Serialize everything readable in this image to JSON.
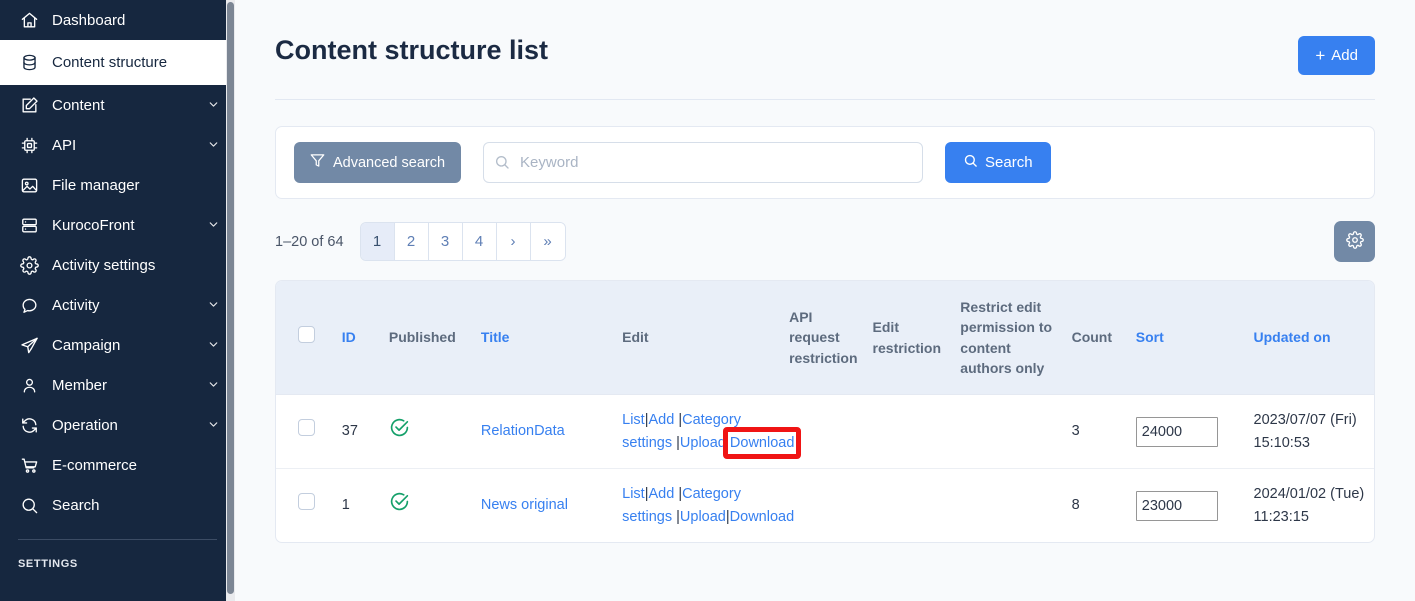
{
  "sidebar": {
    "scroll": "sidebar-scrollbar",
    "items": [
      {
        "id": "dashboard",
        "label": "Dashboard",
        "icon": "home-icon",
        "expandable": false,
        "active": false
      },
      {
        "id": "content-structure",
        "label": "Content structure",
        "icon": "database-icon",
        "expandable": false,
        "active": true
      },
      {
        "id": "content",
        "label": "Content",
        "icon": "edit-square-icon",
        "expandable": true,
        "active": false
      },
      {
        "id": "api",
        "label": "API",
        "icon": "chip-icon",
        "expandable": true,
        "active": false
      },
      {
        "id": "file-manager",
        "label": "File manager",
        "icon": "image-icon",
        "expandable": false,
        "active": false
      },
      {
        "id": "kurocofront",
        "label": "KurocoFront",
        "icon": "server-icon",
        "expandable": true,
        "active": false
      },
      {
        "id": "activity-settings",
        "label": "Activity settings",
        "icon": "gear-icon",
        "expandable": false,
        "active": false
      },
      {
        "id": "activity",
        "label": "Activity",
        "icon": "chat-bubble-icon",
        "expandable": true,
        "active": false
      },
      {
        "id": "campaign",
        "label": "Campaign",
        "icon": "paper-plane-icon",
        "expandable": true,
        "active": false
      },
      {
        "id": "member",
        "label": "Member",
        "icon": "user-icon",
        "expandable": true,
        "active": false
      },
      {
        "id": "operation",
        "label": "Operation",
        "icon": "refresh-icon",
        "expandable": true,
        "active": false
      },
      {
        "id": "e-commerce",
        "label": "E-commerce",
        "icon": "shopping-cart-icon",
        "expandable": false,
        "active": false
      },
      {
        "id": "search",
        "label": "Search",
        "icon": "search-icon",
        "expandable": false,
        "active": false
      }
    ],
    "section_title": "SETTINGS"
  },
  "header": {
    "title": "Content structure list",
    "add_button": {
      "label": "Add",
      "plus": "+"
    }
  },
  "search": {
    "advanced_label": "Advanced search",
    "advanced_icon": "filter-icon",
    "keyword_value": "",
    "keyword_placeholder": "Keyword",
    "keyword_icon": "search-icon",
    "search_label": "Search",
    "search_icon": "search-icon"
  },
  "pagination": {
    "count_text": "1–20 of 64",
    "pages": [
      {
        "label": "1",
        "active": true,
        "name": "page-1"
      },
      {
        "label": "2",
        "active": false,
        "name": "page-2"
      },
      {
        "label": "3",
        "active": false,
        "name": "page-3"
      },
      {
        "label": "4",
        "active": false,
        "name": "page-4"
      },
      {
        "label": "›",
        "active": false,
        "name": "page-next"
      },
      {
        "label": "»",
        "active": false,
        "name": "page-last"
      }
    ],
    "settings_icon": "gear-icon"
  },
  "table": {
    "select_all_name": "select-all-checkbox",
    "columns": [
      {
        "key": "checkbox",
        "label": "",
        "link": false
      },
      {
        "key": "id",
        "label": "ID",
        "link": true
      },
      {
        "key": "published",
        "label": "Published",
        "link": false
      },
      {
        "key": "title",
        "label": "Title",
        "link": true
      },
      {
        "key": "edit",
        "label": "Edit",
        "link": false
      },
      {
        "key": "api_req",
        "label": "API request restriction",
        "link": false
      },
      {
        "key": "edit_res",
        "label": "Edit restriction",
        "link": false
      },
      {
        "key": "restrict",
        "label": "Restrict edit permission to content authors only",
        "link": false
      },
      {
        "key": "count",
        "label": "Count",
        "link": false
      },
      {
        "key": "sort",
        "label": "Sort",
        "link": true
      },
      {
        "key": "updated",
        "label": "Updated on",
        "link": true
      }
    ],
    "rows": [
      {
        "id": "37",
        "published_icon": "check-circle-icon",
        "title": "RelationData",
        "edit_links": [
          "List",
          "|",
          "Add",
          " |",
          "Category settings",
          " |",
          "Upload",
          " ",
          "Download"
        ],
        "api_request_restriction": "",
        "edit_restriction": "",
        "restrict_edit_permission": "",
        "count": "3",
        "sort": "24000",
        "updated_on": "2023/07/07 (Fri) 15:10:53"
      },
      {
        "id": "1",
        "published_icon": "check-circle-icon",
        "title": "News original",
        "edit_links": [
          "List",
          "|",
          "Add",
          " |",
          "Category settings",
          " |",
          "Upload",
          "|",
          "Download"
        ],
        "api_request_restriction": "",
        "edit_restriction": "",
        "restrict_edit_permission": "",
        "count": "8",
        "sort": "23000",
        "updated_on": "2024/01/02 (Tue) 11:23:15"
      }
    ]
  },
  "annotation": {
    "highlight_target": "Download",
    "color": "#f01414"
  },
  "colors": {
    "sidebar_bg": "#16273f",
    "accent_blue": "#3780f0",
    "muted_blue": "#7289a6",
    "table_header_bg": "#e9eff8",
    "published_green": "#15a06a",
    "page_bg": "#f8fafc"
  }
}
